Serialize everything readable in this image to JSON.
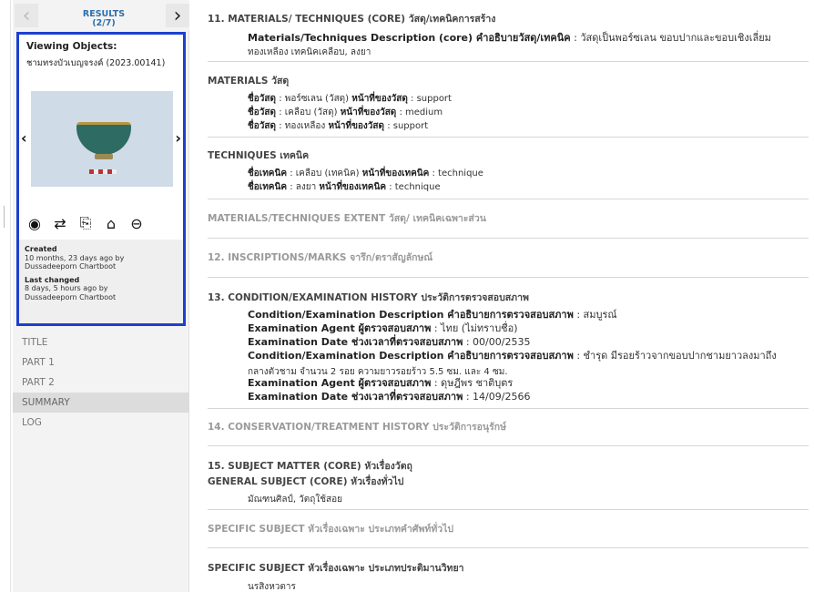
{
  "sidebar": {
    "results_label": "RESULTS",
    "results_count": "(2/7)",
    "prev_icon": "chevron-left",
    "next_icon": "chevron-right",
    "viewer_title": "Viewing Objects:",
    "object_name": "ชามทรงบัวเบญจรงค์ (2023.00141)",
    "tools": [
      "eye-icon",
      "retweet-icon",
      "copy-icon",
      "home-icon",
      "minus-circle-icon"
    ],
    "created_label": "Created",
    "created_value": "10 months, 23 days ago by",
    "created_by": "Dussadeeporn Chartboot",
    "changed_label": "Last changed",
    "changed_value": "8 days, 5 hours ago by",
    "changed_by": "Dussadeeporn Chartboot",
    "menu": [
      {
        "label": "TITLE",
        "active": false
      },
      {
        "label": "PART 1",
        "active": false
      },
      {
        "label": "PART 2",
        "active": false
      },
      {
        "label": "SUMMARY",
        "active": true
      },
      {
        "label": "LOG",
        "active": false
      }
    ]
  },
  "main": {
    "s11": {
      "heading": "11. MATERIALS/ TECHNIQUES (CORE) วัสดุ/เทคนิคการสร้าง",
      "desc_label": "Materials/Techniques Description (core) คำอธิบายวัสดุ/เทคนิค",
      "desc_value": " : วัสดุเป็นพอร์ซเลน ขอบปากและขอบเชิงเลี่ยม",
      "desc_value2": "ทองเหลือง เทคนิคเคลือบ, ลงยา"
    },
    "materials": {
      "heading": "MATERIALS วัสดุ",
      "rows": [
        {
          "l1": "ชื่อวัสดุ",
          "v1": " : พอร์ซเลน (วัสดุ) ",
          "l2": "หน้าที่ของวัสดุ",
          "v2": " : support"
        },
        {
          "l1": "ชื่อวัสดุ",
          "v1": " : เคลือบ (วัสดุ) ",
          "l2": "หน้าที่ของวัสดุ",
          "v2": " : medium"
        },
        {
          "l1": "ชื่อวัสดุ",
          "v1": " : ทองเหลือง ",
          "l2": "หน้าที่ของวัสดุ",
          "v2": " : support"
        }
      ]
    },
    "techniques": {
      "heading": "TECHNIQUES เทคนิค",
      "rows": [
        {
          "l1": "ชื่อเทคนิค",
          "v1": " : เคลือบ (เทคนิค) ",
          "l2": "หน้าที่ของเทคนิค",
          "v2": " : technique"
        },
        {
          "l1": "ชื่อเทคนิค",
          "v1": " : ลงยา ",
          "l2": "หน้าที่ของเทคนิค",
          "v2": " : technique"
        }
      ]
    },
    "extent_heading": "MATERIALS/TECHNIQUES EXTENT วัสดุ/ เทคนิคเฉพาะส่วน",
    "inscriptions_heading": "12. INSCRIPTIONS/MARKS จารึก/ตราสัญลักษณ์",
    "s13": {
      "heading": "13. CONDITION/EXAMINATION HISTORY ประวัติการตรวจสอบสภาพ",
      "cond1_label": "Condition/Examination Description คำอธิบายการตรวจสอบสภาพ",
      "cond1_value": " : สมบูรณ์",
      "agent1_label": "Examination Agent ผู้ตรวจสอบสภาพ",
      "agent1_value": " : ไทย (ไม่ทราบชื่อ)",
      "date1_label": "Examination Date ช่วงเวลาที่ตรวจสอบสภาพ",
      "date1_value": " : 00/00/2535",
      "cond2_label": "Condition/Examination Description คำอธิบายการตรวจสอบสภาพ",
      "cond2_value": " : ชำรุด มีรอยร้าวจากขอบปากชามยาวลงมาถึง",
      "cond2_value2": "กลางตัวชาม จำนวน 2 รอย ความยาวรอยร้าว 5.5 ซม. และ 4 ซม.",
      "agent2_label": "Examination Agent ผู้ตรวจสอบสภาพ",
      "agent2_value": " : ดุษฎีพร ชาติบุตร",
      "date2_label": "Examination Date ช่วงเวลาที่ตรวจสอบสภาพ",
      "date2_value": " : 14/09/2566"
    },
    "conservation_heading": "14. CONSERVATION/TREATMENT HISTORY ประวัติการอนุรักษ์",
    "s15": {
      "heading": "15. SUBJECT MATTER (CORE) หัวเรื่องวัตถุ",
      "subheading": "GENERAL SUBJECT (CORE) หัวเรื่องทั่วไป",
      "value": "มัณฑนศิลป์, วัตถุใช้สอย"
    },
    "specific1_heading": "SPECIFIC SUBJECT หัวเรื่องเฉพาะ ประเภทคำศัพท์ทั่วไป",
    "specific2_heading": "SPECIFIC SUBJECT หัวเรื่องเฉพาะ ประเภทประติมานวิทยา",
    "specific2_value": "นรสิงหวตาร"
  }
}
